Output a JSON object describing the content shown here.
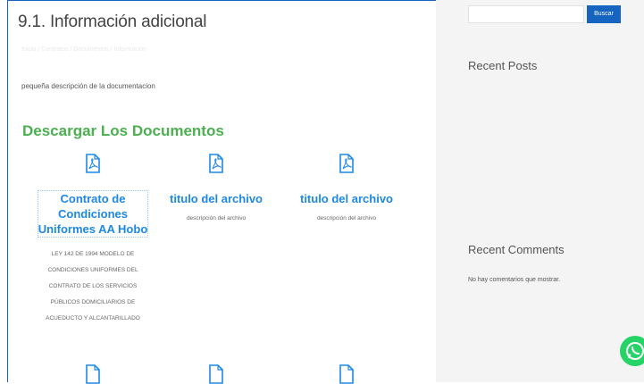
{
  "main": {
    "title": "9.1. Información adicional",
    "breadcrumb": "Inicio / Contratos / Documentos / Información",
    "description": "pequeña descripción de la documentacion",
    "section_heading": "Descargar Los Documentos",
    "documents": [
      {
        "title_lines": [
          "Contrato de",
          "Condiciones",
          "Uniformes AA Hobo"
        ],
        "description_lines": [
          "LEY 142 DE 1994 MODELO DE",
          "CONDICIONES UNIFORMES DEL",
          "CONTRATO DE LOS SERVICIOS",
          "PÚBLICOS DOMICILIARIOS DE",
          "ACUEDUCTO Y ALCANTARILLADO"
        ]
      },
      {
        "title_lines": [
          "titulo del archivo"
        ],
        "description_lines": [
          "descripción del archivo"
        ]
      },
      {
        "title_lines": [
          "titulo del archivo"
        ],
        "description_lines": [
          "descripción del archivo"
        ]
      }
    ],
    "icon": "pdf-file-icon"
  },
  "sidebar": {
    "search": {
      "value": "",
      "button_label": "Buscar"
    },
    "recent_posts_title": "Recent Posts",
    "recent_comments_title": "Recent Comments",
    "no_comments_text": "No hay comentarios que mostrar."
  },
  "floating": {
    "icon": "whatsapp-icon"
  },
  "colors": {
    "primary": "#1565c0",
    "link": "#1e88e5",
    "heading_green": "#4caf50",
    "whatsapp": "#25d366"
  }
}
